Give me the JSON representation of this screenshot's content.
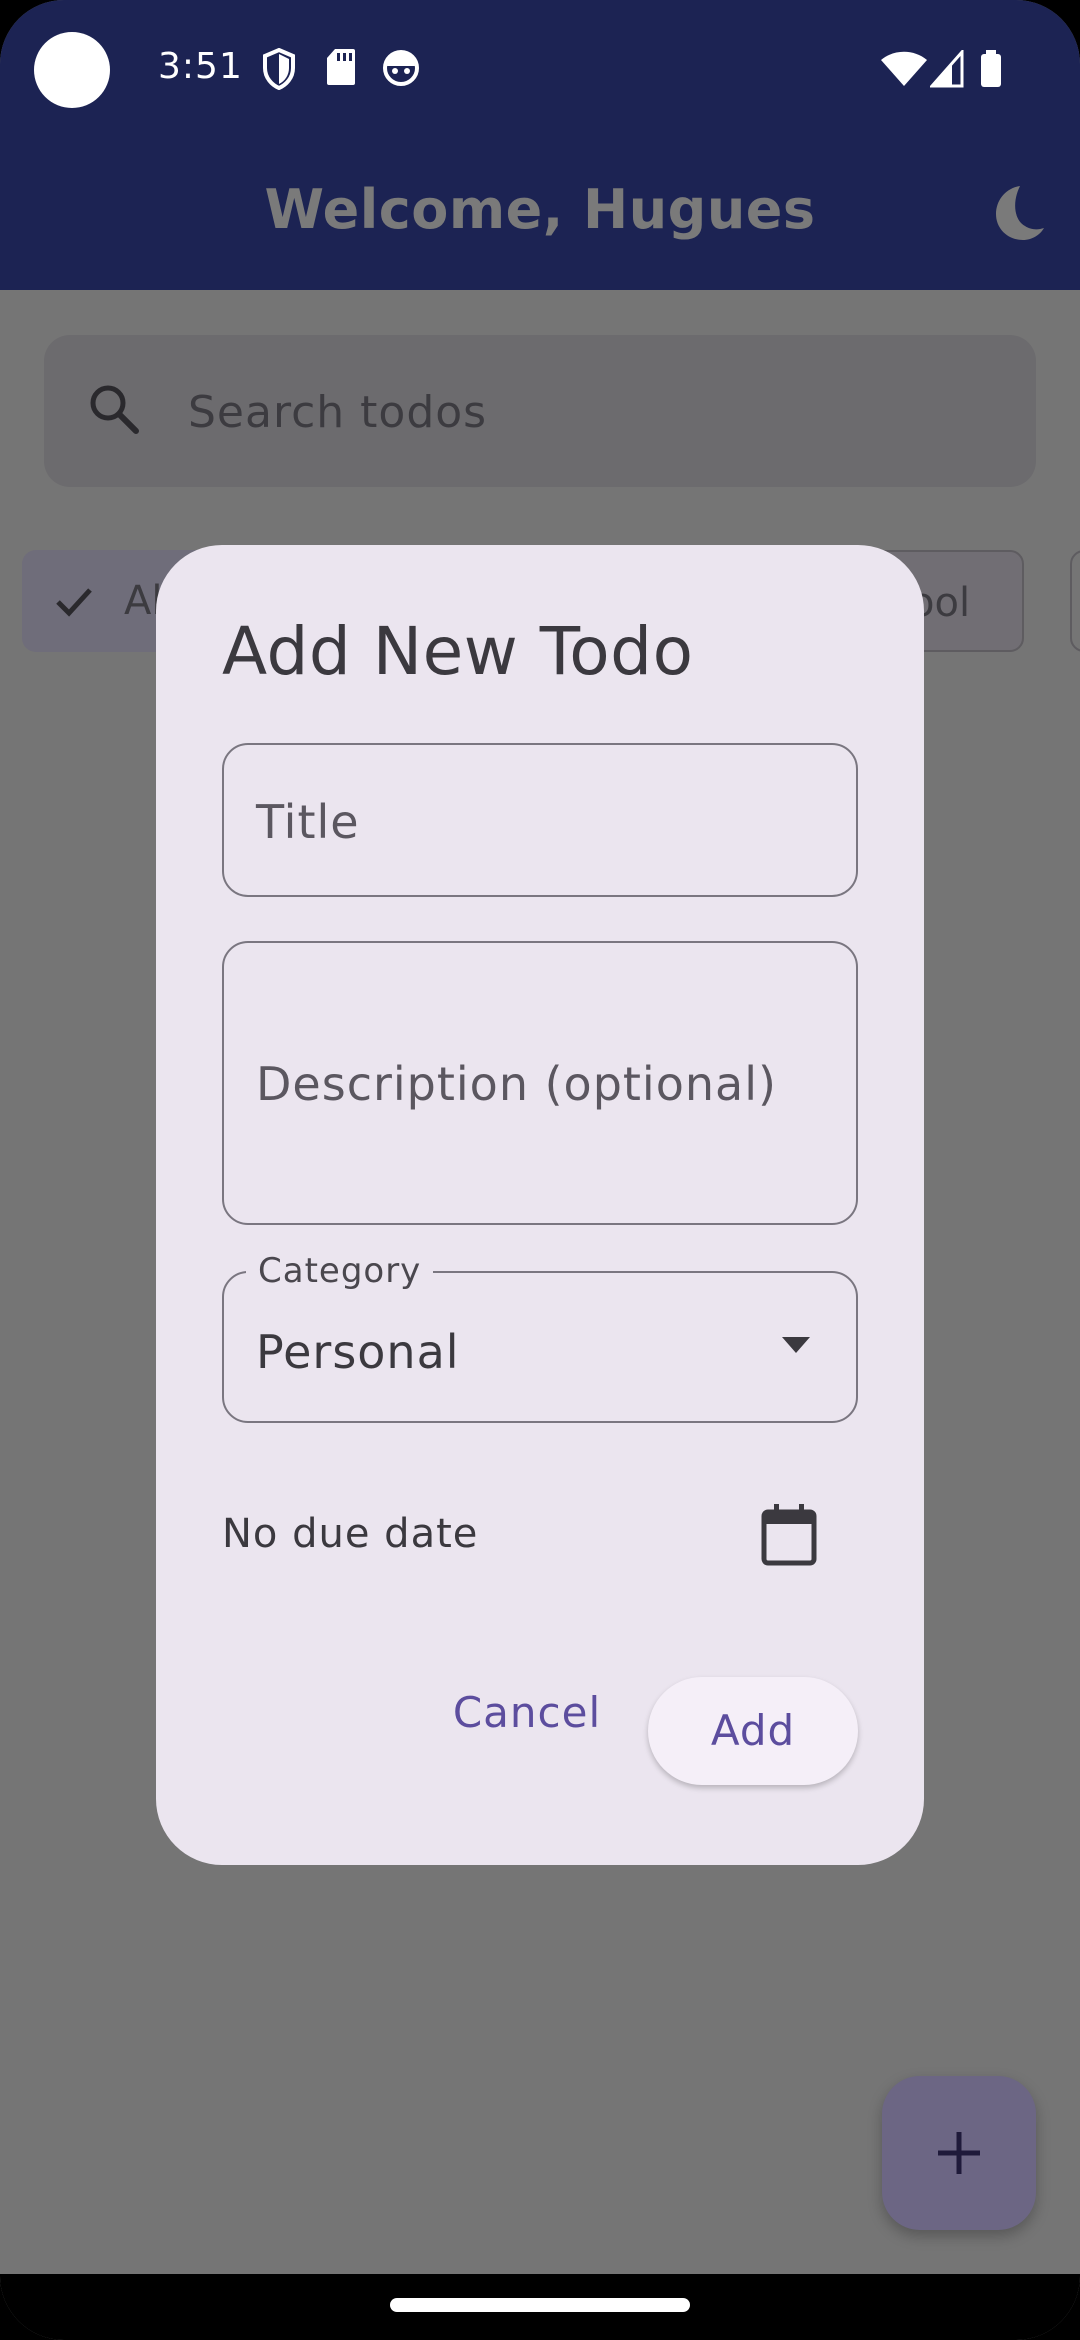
{
  "status_bar": {
    "time": "3:51",
    "left_icons": [
      "shield-icon",
      "sd-card-icon",
      "android-face-icon"
    ],
    "right_icons": [
      "wifi-icon",
      "signal-icon",
      "battery-icon"
    ]
  },
  "app_bar": {
    "title": "Welcome, Hugues",
    "theme_icon": "moon-icon"
  },
  "background": {
    "search": {
      "placeholder": "Search todos",
      "icon": "search-icon"
    },
    "chips": [
      {
        "label": "Al",
        "selected": true,
        "icon": "check-icon"
      },
      {
        "label": "ool",
        "selected": false
      }
    ],
    "fab": {
      "icon": "plus-icon"
    }
  },
  "dialog": {
    "title": "Add New Todo",
    "title_field": {
      "placeholder": "Title",
      "value": ""
    },
    "description_field": {
      "placeholder": "Description (optional)",
      "value": ""
    },
    "category": {
      "label": "Category",
      "value": "Personal"
    },
    "due_date_text": "No due date",
    "cancel_label": "Cancel",
    "add_label": "Add"
  },
  "colors": {
    "app_bar": "#1c2353",
    "scrim": "#757575",
    "dialog_bg": "#ebe5ef",
    "accent": "#5c4d9e"
  }
}
